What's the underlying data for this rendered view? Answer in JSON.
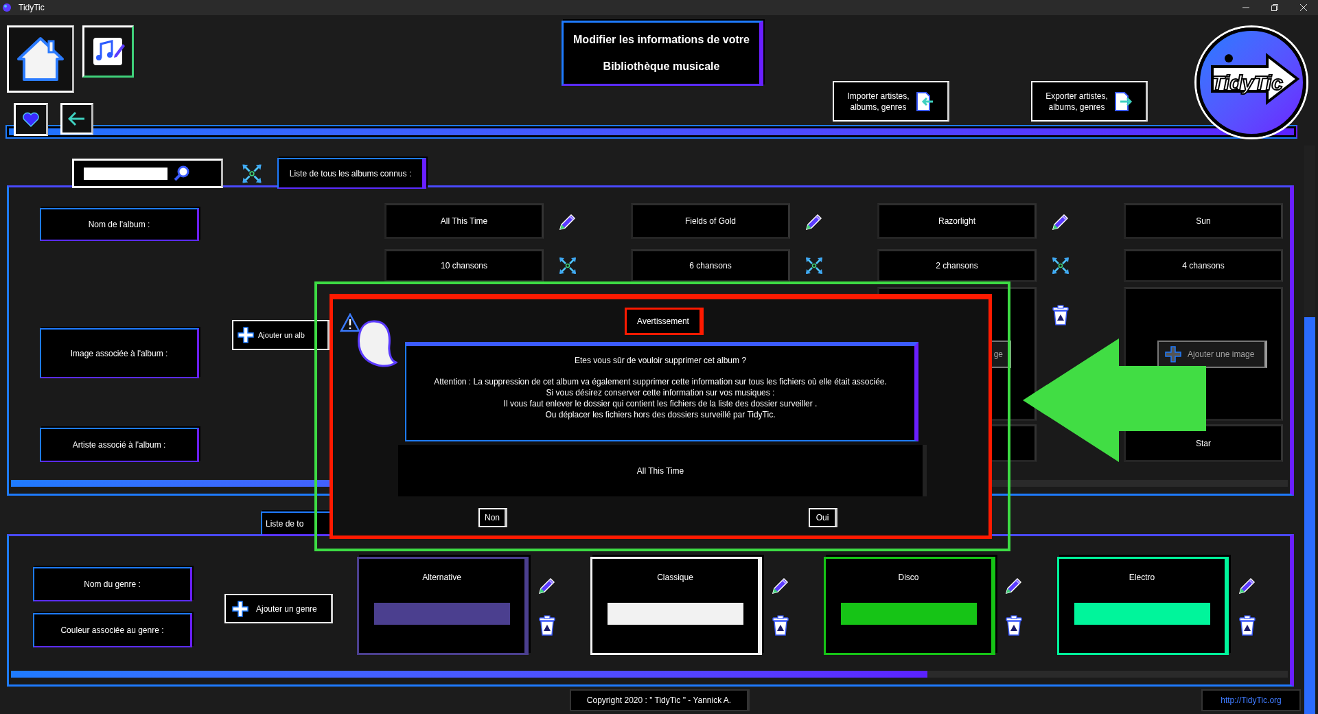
{
  "window": {
    "title": "TidyTic"
  },
  "header": {
    "title_lines": [
      "Modifier les informations de votre",
      "Bibliothèque musicale"
    ],
    "import_button": "Importer artistes,\nalbums, genres",
    "export_button": "Exporter artistes,\nalbums, genres",
    "logo": "TidyTic"
  },
  "albums": {
    "list_tab": "Liste de tous les albums connus :",
    "row_labels": [
      "Nom de l'album :",
      "Image associée à l'album :",
      "Artiste associé à l'album :"
    ],
    "add_button": "Ajouter un alb",
    "columns": [
      {
        "name": "All This Time",
        "songs": "10 chansons"
      },
      {
        "name": "Fields of Gold",
        "songs": "6 chansons"
      },
      {
        "name": "Razorlight",
        "songs": "2 chansons",
        "image_button": "ge"
      },
      {
        "name": "Sun",
        "songs": "4 chansons",
        "image_button": "Ajouter une image",
        "artist": "Star"
      }
    ]
  },
  "genres": {
    "list_tab": "Liste de to",
    "row_labels": [
      "Nom du genre :",
      "Couleur associée au genre :"
    ],
    "add_button": "Ajouter un genre",
    "items": [
      {
        "name": "Alternative",
        "color": "#4b3f8f"
      },
      {
        "name": "Classique",
        "color": "#f2f2f2"
      },
      {
        "name": "Disco",
        "color": "#16c416"
      },
      {
        "name": "Electro",
        "color": "#00f59b"
      }
    ]
  },
  "footer": {
    "copyright": "Copyright 2020 : \" TidyTic \" - Yannick A.",
    "link": "http://TidyTic.org"
  },
  "dialog": {
    "title": "Avertissement",
    "question": "Etes vous sûr de vouloir supprimer cet album ?",
    "message_lines": [
      "Attention : La suppression de cet album va également supprimer cette information sur tous les fichiers où elle était associée.",
      "Si vous désirez conserver cette information sur vos musiques :",
      "Il vous faut enlever le dossier qui contient les fichiers de la liste des dossier surveiller .",
      "Ou déplacer les fichiers hors des dossiers surveillé par TidyTic."
    ],
    "subject": "All This Time",
    "buttons": [
      "Non",
      "Oui"
    ]
  }
}
